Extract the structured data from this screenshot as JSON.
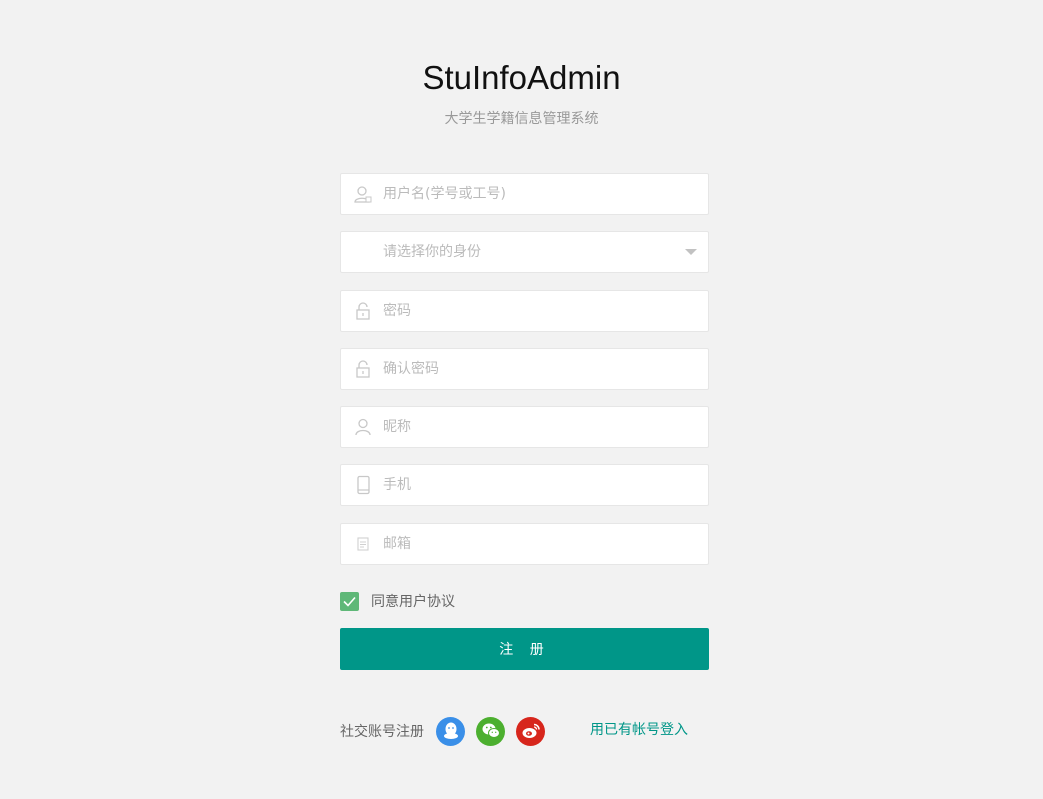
{
  "header": {
    "title": "StuInfoAdmin",
    "subtitle": "大学生学籍信息管理系统"
  },
  "form": {
    "username_placeholder": "用户名(学号或工号)",
    "role_placeholder": "请选择你的身份",
    "password_placeholder": "密码",
    "confirm_password_placeholder": "确认密码",
    "nickname_placeholder": "昵称",
    "phone_placeholder": "手机",
    "email_placeholder": "邮箱",
    "agree_label": "同意用户协议",
    "agree_checked": true,
    "submit_label": "注 册"
  },
  "footer": {
    "social_label": "社交账号注册",
    "social_icons": [
      "qq-icon",
      "wechat-icon",
      "weibo-icon"
    ],
    "login_link": "用已有帐号登入"
  },
  "colors": {
    "primary": "#009688",
    "checkbox": "#5fb878",
    "qq": "#3a8fe8",
    "wechat": "#4caf2f",
    "weibo": "#d7261c"
  }
}
